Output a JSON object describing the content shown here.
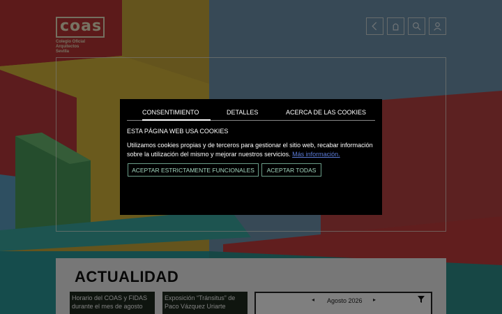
{
  "header": {
    "logo_text": "coas",
    "logo_sub": [
      "Colegio Oficial",
      "Arquitectos",
      "Sevilla"
    ],
    "buttons": [
      "back-icon",
      "home-icon",
      "search-icon",
      "user-icon"
    ]
  },
  "news": {
    "title": "ACTUALIDAD",
    "cards": [
      "Horario del COAS y FIDAS durante el mes de agosto",
      "Exposición “Tránsitus” de Paco Vázquez Uriarte"
    ],
    "calendar": {
      "month": "Agosto 2026",
      "prev": "◂",
      "next": "▸",
      "filter_icon": "filter-icon"
    }
  },
  "cookie": {
    "tabs": [
      "CONSENTIMIENTO",
      "DETALLES",
      "ACERCA DE LAS COOKIES"
    ],
    "active_tab": "CONSENTIMIENTO",
    "heading": "ESTA PÁGINA WEB USA COOKIES",
    "body": "Utilizamos cookies propias y de terceros para gestionar el sitio web, recabar información sobre la utilización del mismo y mejorar nuestros servicios.",
    "more_link": "Más información.",
    "buttons": {
      "functional": "ACEPTAR ESTRICTAMENTE FUNCIONALES",
      "all": "ACEPTAR TODAS"
    },
    "accent": "#6b9e89"
  }
}
